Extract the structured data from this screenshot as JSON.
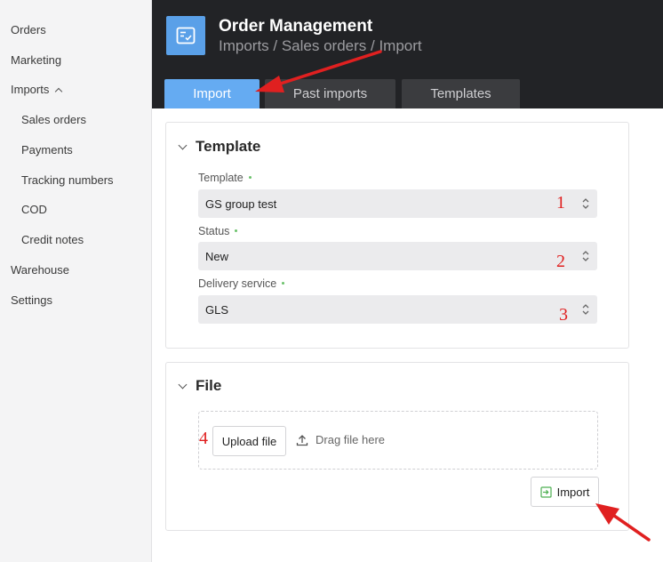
{
  "sidebar": {
    "items": [
      {
        "label": "Orders"
      },
      {
        "label": "Marketing"
      },
      {
        "label": "Imports"
      },
      {
        "label": "Sales orders"
      },
      {
        "label": "Payments"
      },
      {
        "label": "Tracking numbers"
      },
      {
        "label": "COD"
      },
      {
        "label": "Credit notes"
      },
      {
        "label": "Warehouse"
      },
      {
        "label": "Settings"
      }
    ]
  },
  "header": {
    "title": "Order Management",
    "breadcrumb": "Imports / Sales orders / Import"
  },
  "tabs": [
    {
      "label": "Import",
      "active": true
    },
    {
      "label": "Past imports"
    },
    {
      "label": "Templates"
    }
  ],
  "template_card": {
    "title": "Template",
    "fields": [
      {
        "label": "Template",
        "value": "GS group test",
        "marker": "1"
      },
      {
        "label": "Status",
        "value": "New",
        "marker": "2"
      },
      {
        "label": "Delivery service",
        "value": "GLS",
        "marker": "3"
      }
    ]
  },
  "file_card": {
    "title": "File",
    "upload_label": "Upload file",
    "upload_marker": "4",
    "drag_hint": "Drag file here",
    "import_label": "Import"
  },
  "colors": {
    "header_bg": "#222326",
    "accent": "#65abf2",
    "annotation": "#e02020",
    "required_dot": "#6bc26b"
  }
}
